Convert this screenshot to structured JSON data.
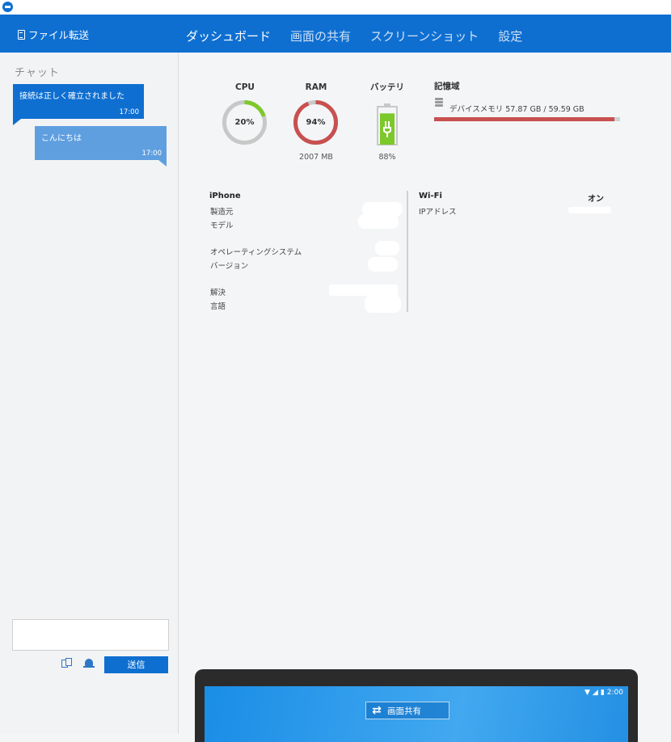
{
  "header": {
    "file_transfer_label": "ファイル転送",
    "tabs": [
      {
        "label": "ダッシュボード",
        "active": true
      },
      {
        "label": "画面の共有",
        "active": false
      },
      {
        "label": "スクリーンショット",
        "active": false
      },
      {
        "label": "設定",
        "active": false
      }
    ]
  },
  "chat": {
    "title": "チャット",
    "messages": [
      {
        "text": "接続は正しく確立されました",
        "time": "17:00"
      },
      {
        "text": "こんにちは",
        "time": "17:00"
      }
    ],
    "input_value": "",
    "send_label": "送信"
  },
  "metrics": {
    "cpu": {
      "label": "CPU",
      "percent_text": "20%",
      "fraction": 0.2,
      "color": "#7dc82a"
    },
    "ram": {
      "label": "RAM",
      "percent_text": "94%",
      "fraction": 0.94,
      "color": "#c85050",
      "amount": "2007 MB"
    },
    "battery": {
      "label": "バッテリ",
      "percent_text": "88%",
      "fraction": 0.88,
      "color": "#7dc82a"
    },
    "storage": {
      "label": "記憶域",
      "name": "デバイスメモリ",
      "value_text": "57.87 GB / 59.59 GB",
      "fraction": 0.971,
      "color": "#c85050"
    }
  },
  "device_info": {
    "title": "iPhone",
    "manufacturer_label": "製造元",
    "model_label": "モデル",
    "os_label": "オペレーティングシステム",
    "version_label": "バージョン",
    "resolution_label": "解決",
    "language_label": "言語"
  },
  "wifi": {
    "title": "Wi-Fi",
    "status": "オン",
    "ip_label": "IPアドレス"
  },
  "preview": {
    "time": "2:00",
    "share_label": "画面共有"
  },
  "colors": {
    "brand": "#0e6fd1",
    "accent_green": "#7dc82a",
    "accent_red": "#c85050"
  }
}
